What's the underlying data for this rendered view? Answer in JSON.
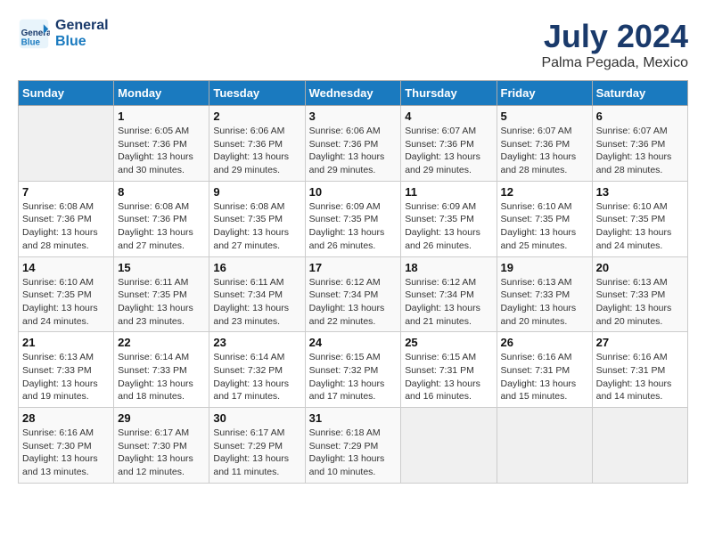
{
  "header": {
    "logo_line1": "General",
    "logo_line2": "Blue",
    "title": "July 2024",
    "subtitle": "Palma Pegada, Mexico"
  },
  "weekdays": [
    "Sunday",
    "Monday",
    "Tuesday",
    "Wednesday",
    "Thursday",
    "Friday",
    "Saturday"
  ],
  "weeks": [
    [
      {
        "num": "",
        "info": ""
      },
      {
        "num": "1",
        "info": "Sunrise: 6:05 AM\nSunset: 7:36 PM\nDaylight: 13 hours\nand 30 minutes."
      },
      {
        "num": "2",
        "info": "Sunrise: 6:06 AM\nSunset: 7:36 PM\nDaylight: 13 hours\nand 29 minutes."
      },
      {
        "num": "3",
        "info": "Sunrise: 6:06 AM\nSunset: 7:36 PM\nDaylight: 13 hours\nand 29 minutes."
      },
      {
        "num": "4",
        "info": "Sunrise: 6:07 AM\nSunset: 7:36 PM\nDaylight: 13 hours\nand 29 minutes."
      },
      {
        "num": "5",
        "info": "Sunrise: 6:07 AM\nSunset: 7:36 PM\nDaylight: 13 hours\nand 28 minutes."
      },
      {
        "num": "6",
        "info": "Sunrise: 6:07 AM\nSunset: 7:36 PM\nDaylight: 13 hours\nand 28 minutes."
      }
    ],
    [
      {
        "num": "7",
        "info": "Sunrise: 6:08 AM\nSunset: 7:36 PM\nDaylight: 13 hours\nand 28 minutes."
      },
      {
        "num": "8",
        "info": "Sunrise: 6:08 AM\nSunset: 7:36 PM\nDaylight: 13 hours\nand 27 minutes."
      },
      {
        "num": "9",
        "info": "Sunrise: 6:08 AM\nSunset: 7:35 PM\nDaylight: 13 hours\nand 27 minutes."
      },
      {
        "num": "10",
        "info": "Sunrise: 6:09 AM\nSunset: 7:35 PM\nDaylight: 13 hours\nand 26 minutes."
      },
      {
        "num": "11",
        "info": "Sunrise: 6:09 AM\nSunset: 7:35 PM\nDaylight: 13 hours\nand 26 minutes."
      },
      {
        "num": "12",
        "info": "Sunrise: 6:10 AM\nSunset: 7:35 PM\nDaylight: 13 hours\nand 25 minutes."
      },
      {
        "num": "13",
        "info": "Sunrise: 6:10 AM\nSunset: 7:35 PM\nDaylight: 13 hours\nand 24 minutes."
      }
    ],
    [
      {
        "num": "14",
        "info": "Sunrise: 6:10 AM\nSunset: 7:35 PM\nDaylight: 13 hours\nand 24 minutes."
      },
      {
        "num": "15",
        "info": "Sunrise: 6:11 AM\nSunset: 7:35 PM\nDaylight: 13 hours\nand 23 minutes."
      },
      {
        "num": "16",
        "info": "Sunrise: 6:11 AM\nSunset: 7:34 PM\nDaylight: 13 hours\nand 23 minutes."
      },
      {
        "num": "17",
        "info": "Sunrise: 6:12 AM\nSunset: 7:34 PM\nDaylight: 13 hours\nand 22 minutes."
      },
      {
        "num": "18",
        "info": "Sunrise: 6:12 AM\nSunset: 7:34 PM\nDaylight: 13 hours\nand 21 minutes."
      },
      {
        "num": "19",
        "info": "Sunrise: 6:13 AM\nSunset: 7:33 PM\nDaylight: 13 hours\nand 20 minutes."
      },
      {
        "num": "20",
        "info": "Sunrise: 6:13 AM\nSunset: 7:33 PM\nDaylight: 13 hours\nand 20 minutes."
      }
    ],
    [
      {
        "num": "21",
        "info": "Sunrise: 6:13 AM\nSunset: 7:33 PM\nDaylight: 13 hours\nand 19 minutes."
      },
      {
        "num": "22",
        "info": "Sunrise: 6:14 AM\nSunset: 7:33 PM\nDaylight: 13 hours\nand 18 minutes."
      },
      {
        "num": "23",
        "info": "Sunrise: 6:14 AM\nSunset: 7:32 PM\nDaylight: 13 hours\nand 17 minutes."
      },
      {
        "num": "24",
        "info": "Sunrise: 6:15 AM\nSunset: 7:32 PM\nDaylight: 13 hours\nand 17 minutes."
      },
      {
        "num": "25",
        "info": "Sunrise: 6:15 AM\nSunset: 7:31 PM\nDaylight: 13 hours\nand 16 minutes."
      },
      {
        "num": "26",
        "info": "Sunrise: 6:16 AM\nSunset: 7:31 PM\nDaylight: 13 hours\nand 15 minutes."
      },
      {
        "num": "27",
        "info": "Sunrise: 6:16 AM\nSunset: 7:31 PM\nDaylight: 13 hours\nand 14 minutes."
      }
    ],
    [
      {
        "num": "28",
        "info": "Sunrise: 6:16 AM\nSunset: 7:30 PM\nDaylight: 13 hours\nand 13 minutes."
      },
      {
        "num": "29",
        "info": "Sunrise: 6:17 AM\nSunset: 7:30 PM\nDaylight: 13 hours\nand 12 minutes."
      },
      {
        "num": "30",
        "info": "Sunrise: 6:17 AM\nSunset: 7:29 PM\nDaylight: 13 hours\nand 11 minutes."
      },
      {
        "num": "31",
        "info": "Sunrise: 6:18 AM\nSunset: 7:29 PM\nDaylight: 13 hours\nand 10 minutes."
      },
      {
        "num": "",
        "info": ""
      },
      {
        "num": "",
        "info": ""
      },
      {
        "num": "",
        "info": ""
      }
    ]
  ]
}
